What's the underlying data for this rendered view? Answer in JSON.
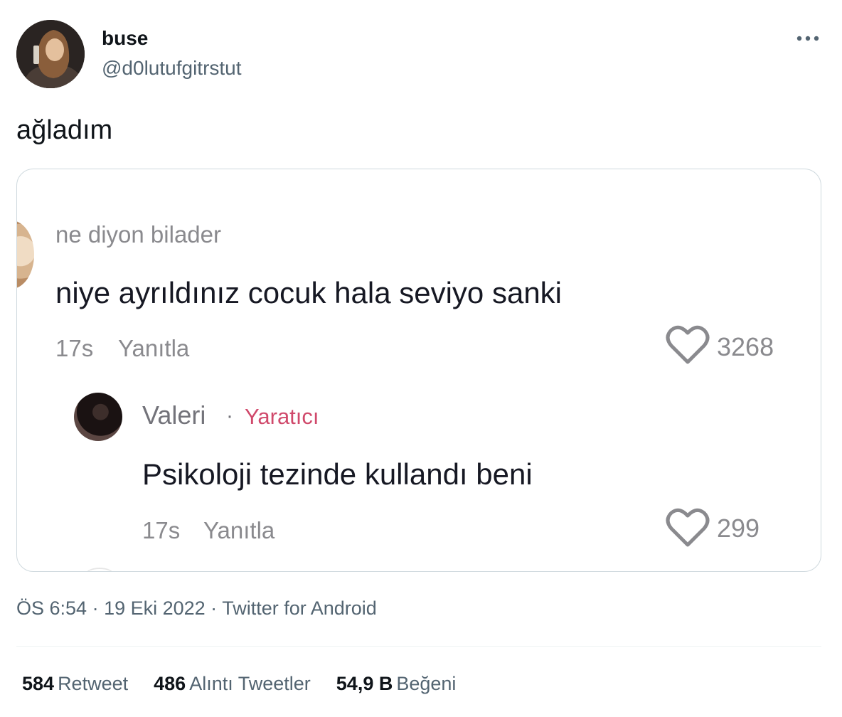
{
  "author": {
    "display_name": "buse",
    "handle": "@d0lutufgitrstut",
    "avatar_icon": "user-avatar"
  },
  "menu": {
    "more_icon": "more-horizontal-icon"
  },
  "tweet": {
    "text": "ağladım"
  },
  "media": {
    "comment": {
      "user": "ne diyon bilader",
      "text": "niye ayrıldınız cocuk hala seviyo sanki",
      "time": "17s",
      "reply_label": "Yanıtla",
      "likes": "3268",
      "like_icon": "heart-icon"
    },
    "reply": {
      "user": "Valeri",
      "separator": "·",
      "badge": "Yaratıcı",
      "badge_color": "#d0496b",
      "text": "Psikoloji tezinde kullandı beni",
      "time": "17s",
      "reply_label": "Yanıtla",
      "likes": "299",
      "like_icon": "heart-icon"
    }
  },
  "meta": {
    "time": "ÖS 6:54",
    "sep1": " · ",
    "date": "19 Eki 2022",
    "sep2": " · ",
    "source": "Twitter for Android"
  },
  "stats": [
    {
      "count": "584",
      "label": "Retweet"
    },
    {
      "count": "486",
      "label": "Alıntı Tweetler"
    },
    {
      "count": "54,9 B",
      "label": "Beğeni"
    }
  ],
  "colors": {
    "text_primary": "#0f1419",
    "text_secondary": "#536471",
    "border": "#cfd9de"
  }
}
